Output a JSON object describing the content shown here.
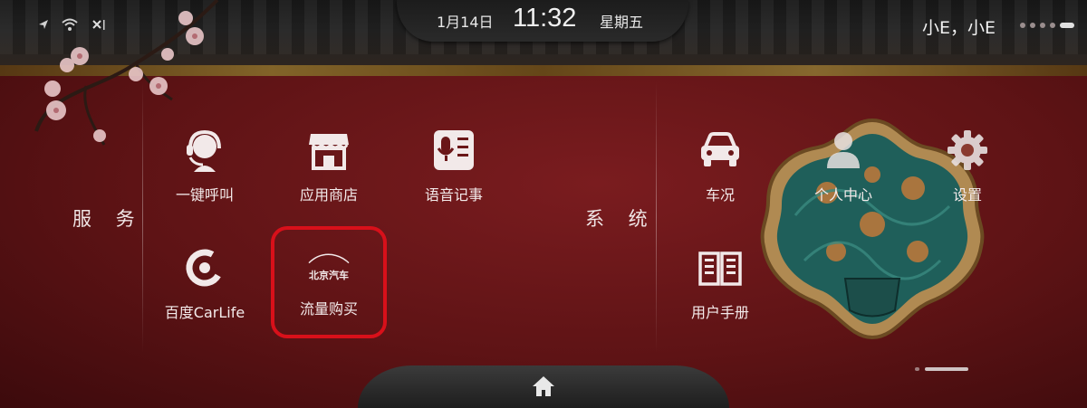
{
  "status_bar": {
    "date": "1月14日",
    "time": "11:32",
    "weekday": "星期五",
    "user_label": "小E，小E",
    "icons": [
      "location-icon",
      "wifi-icon",
      "signal-off-icon"
    ]
  },
  "sections": {
    "services_label": "服 务",
    "system_label": "系 统"
  },
  "apps": {
    "one_key_call": "一键呼叫",
    "app_store": "应用商店",
    "voice_memo": "语音记事",
    "baidu_carlife": "百度CarLife",
    "data_purchase": "流量购买",
    "data_purchase_brand": "北京汽车",
    "vehicle_status": "车况",
    "personal_center": "个人中心",
    "settings": "设置",
    "user_manual": "用户手册"
  },
  "colors": {
    "highlight": "#d8101a",
    "background": "#5e1315"
  }
}
